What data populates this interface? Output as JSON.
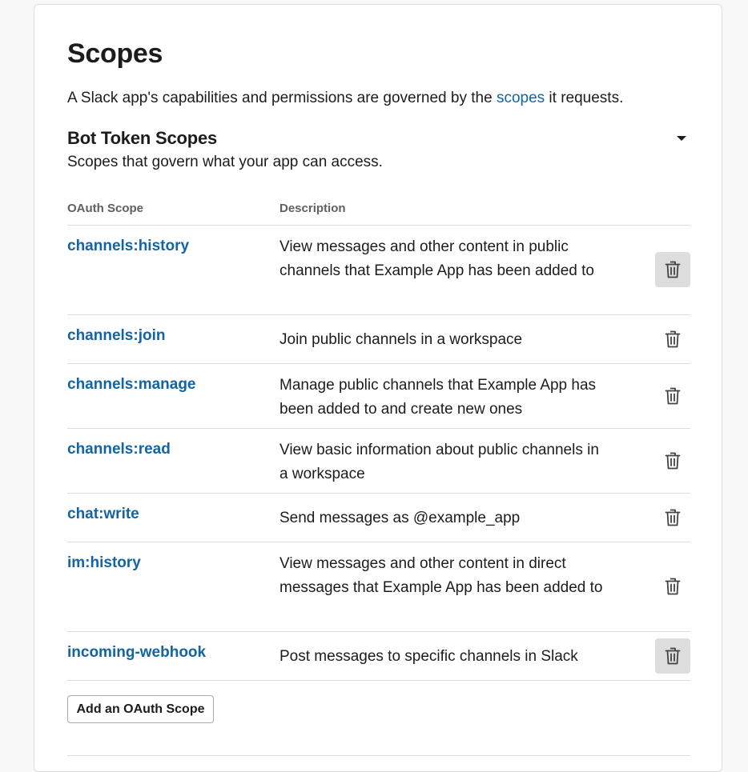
{
  "header": {
    "title": "Scopes",
    "intro_before": "A Slack app's capabilities and permissions are governed by the ",
    "intro_link": "scopes",
    "intro_after": " it requests."
  },
  "bot_section": {
    "title": "Bot Token Scopes",
    "description": "Scopes that govern what your app can access.",
    "columns": {
      "scope": "OAuth Scope",
      "description": "Description"
    },
    "rows": [
      {
        "scope": "channels:history",
        "description": "View messages and other content in public channels that Example App has been added to",
        "delete_highlighted": true
      },
      {
        "scope": "channels:join",
        "description": "Join public channels in a workspace",
        "delete_highlighted": false
      },
      {
        "scope": "channels:manage",
        "description": "Manage public channels that Example App has been added to and create new ones",
        "delete_highlighted": false
      },
      {
        "scope": "channels:read",
        "description": "View basic information about public channels in a workspace",
        "delete_highlighted": false
      },
      {
        "scope": "chat:write",
        "description": "Send messages as @example_app",
        "delete_highlighted": false
      },
      {
        "scope": "im:history",
        "description": "View messages and other content in direct messages that Example App has been added to",
        "delete_highlighted": false
      },
      {
        "scope": "incoming-webhook",
        "description": "Post messages to specific channels in Slack",
        "delete_highlighted": true
      }
    ],
    "add_button": "Add an OAuth Scope"
  },
  "colors": {
    "link": "#1264a3",
    "text": "#1d1c1d",
    "muted": "#616061",
    "border": "#dddddd",
    "highlight": "#dddddd"
  },
  "icons": {
    "collapse": "caret-down-icon",
    "delete": "trash-icon"
  }
}
